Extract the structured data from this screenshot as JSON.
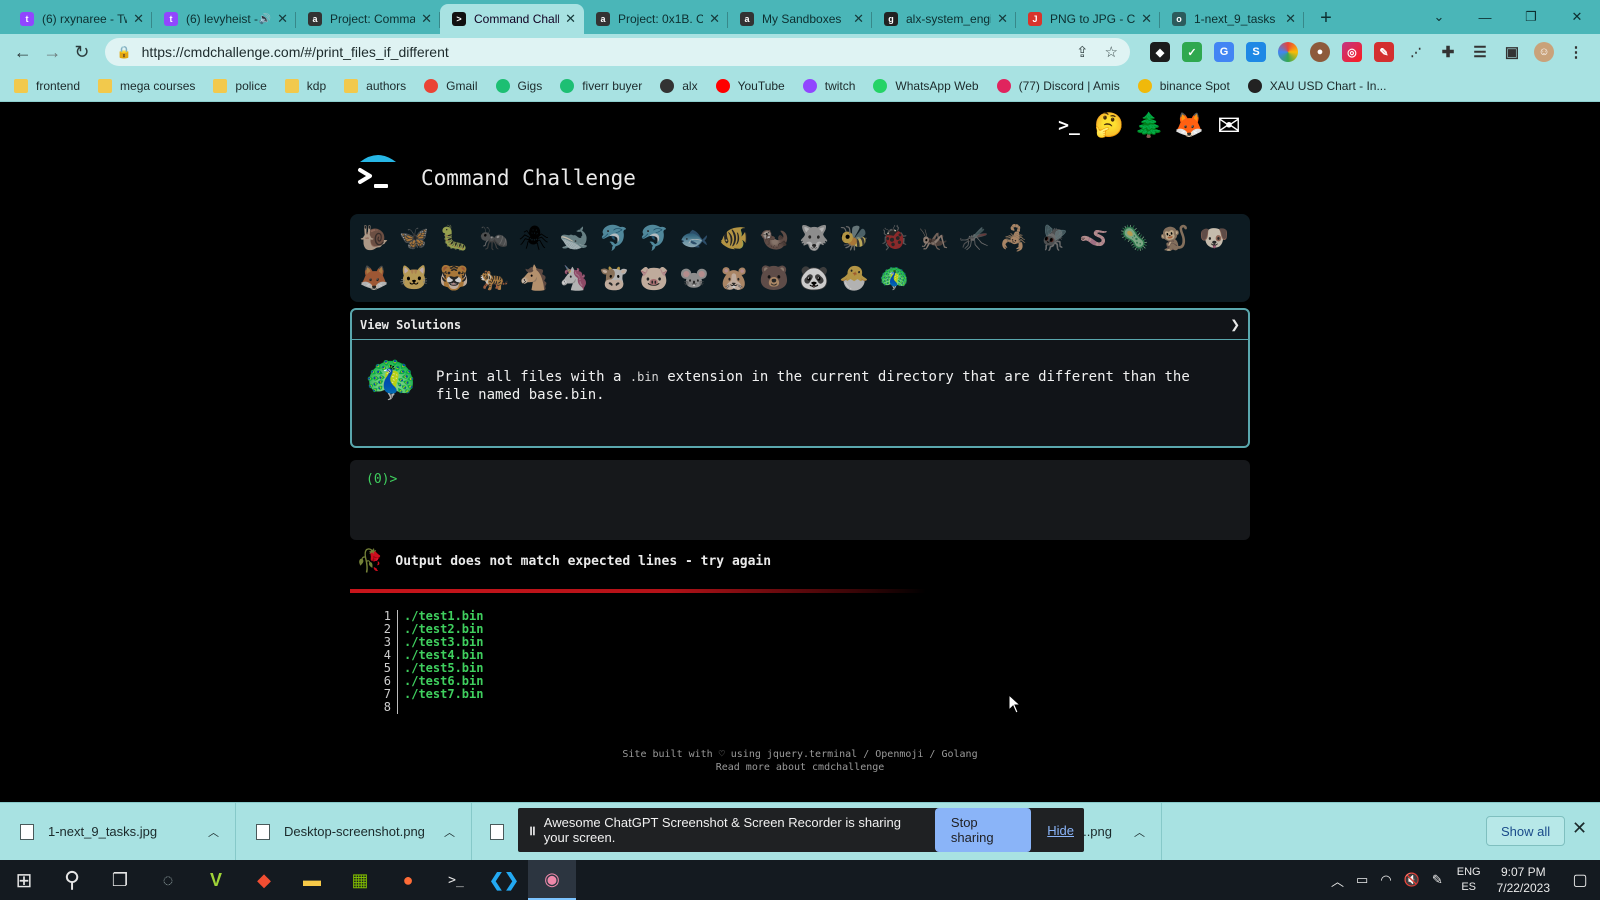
{
  "browser": {
    "tabs": [
      {
        "title": "(6) rxynaree - Twitch",
        "icon": "twitch-icon",
        "color": "#9146ff",
        "glyph": "t",
        "active": false
      },
      {
        "title": "(6) levyheist - Twitch",
        "icon": "twitch-icon",
        "color": "#9146ff",
        "glyph": "t",
        "active": false,
        "audio": true
      },
      {
        "title": "Project: Command line",
        "icon": "alx-icon",
        "color": "#333",
        "glyph": "a",
        "active": false
      },
      {
        "title": "Command Challenge",
        "icon": "terminal-icon",
        "color": "#111",
        "glyph": ">",
        "active": true
      },
      {
        "title": "Project: 0x1B. C",
        "icon": "alx-icon",
        "color": "#333",
        "glyph": "a",
        "active": false
      },
      {
        "title": "My Sandboxes",
        "icon": "alx-icon",
        "color": "#333",
        "glyph": "a",
        "active": false
      },
      {
        "title": "alx-system_engineering",
        "icon": "github-icon",
        "color": "#222",
        "glyph": "g",
        "active": false
      },
      {
        "title": "PNG to JPG - Convert",
        "icon": "png-to-jpg-icon",
        "color": "#d9342b",
        "glyph": "J",
        "active": false
      },
      {
        "title": "1-next_9_tasks",
        "icon": "globe-icon",
        "color": "#2c5b5c",
        "glyph": "o",
        "active": false
      }
    ],
    "url": "https://cmdchallenge.com/#/print_files_if_different",
    "bookmarks": [
      {
        "label": "frontend",
        "type": "folder"
      },
      {
        "label": "mega courses",
        "type": "folder"
      },
      {
        "label": "police",
        "type": "folder"
      },
      {
        "label": "kdp",
        "type": "folder"
      },
      {
        "label": "authors",
        "type": "folder"
      },
      {
        "label": "Gmail",
        "type": "gmail",
        "color": "#ea4335"
      },
      {
        "label": "Gigs",
        "type": "fiverr",
        "color": "#1dbf73"
      },
      {
        "label": "fiverr buyer",
        "type": "fiverr",
        "color": "#1dbf73"
      },
      {
        "label": "alx",
        "type": "alx",
        "color": "#333"
      },
      {
        "label": "YouTube",
        "type": "youtube",
        "color": "#ff0000"
      },
      {
        "label": "twitch",
        "type": "twitch",
        "color": "#9146ff"
      },
      {
        "label": "WhatsApp Web",
        "type": "whatsapp",
        "color": "#25d366"
      },
      {
        "label": "(77) Discord | Amis",
        "type": "discord",
        "color": "#e0245e"
      },
      {
        "label": "binance Spot",
        "type": "binance",
        "color": "#f0b90b"
      },
      {
        "label": "XAU USD Chart - In...",
        "type": "investing",
        "color": "#222"
      }
    ]
  },
  "page": {
    "title": "Command Challenge",
    "top_icons": [
      "🐧",
      "🤔",
      "🌲",
      "🦊",
      "✉"
    ],
    "animals_row1": [
      "🐌",
      "🦋",
      "🐛",
      "🐜",
      "🕷",
      "🐋",
      "🐬",
      "🐬",
      "🐟",
      "🐠",
      "🦦",
      "🐺",
      "🐝",
      "🐞",
      "🦗",
      "🦟",
      "🦂",
      "🪰",
      "🪱",
      "🦠",
      "🐒",
      "🐶"
    ],
    "animals_row2": [
      "🦊",
      "🐱",
      "🐯",
      "🐅",
      "🐴",
      "🦄",
      "🐮",
      "🐷",
      "🐭",
      "🐹",
      "🐻",
      "🐼",
      "🐣",
      "🦚"
    ],
    "view_solutions": "View Solutions",
    "challenge_before": "Print all files with a ",
    "challenge_code": ".bin",
    "challenge_after": " extension in the current directory that are different than the file named base.bin.",
    "terminal_prompt": "(0)>",
    "result_text": "Output does not match expected lines - try again",
    "progress_fraction": 0.55,
    "expected_output": [
      {
        "n": "1",
        "t": "./test1.bin"
      },
      {
        "n": "2",
        "t": "./test2.bin"
      },
      {
        "n": "3",
        "t": "./test3.bin"
      },
      {
        "n": "4",
        "t": "./test4.bin"
      },
      {
        "n": "5",
        "t": "./test5.bin"
      },
      {
        "n": "6",
        "t": "./test6.bin"
      },
      {
        "n": "7",
        "t": "./test7.bin"
      },
      {
        "n": "8",
        "t": ""
      }
    ],
    "footer_line1": "Site built with ♡ using jquery.terminal / Openmoji / Golang",
    "footer_line2": "Read more about cmdchallenge"
  },
  "downloads": {
    "items": [
      "1-next_9_tasks.jpg",
      "Desktop-screenshot.png",
      "...png"
    ],
    "share_text": "Awesome ChatGPT Screenshot & Screen Recorder is sharing your screen.",
    "stop_label": "Stop sharing",
    "hide_label": "Hide",
    "show_all": "Show all"
  },
  "taskbar": {
    "lang1": "ENG",
    "lang2": "ES",
    "time": "9:07 PM",
    "date": "7/22/2023"
  }
}
